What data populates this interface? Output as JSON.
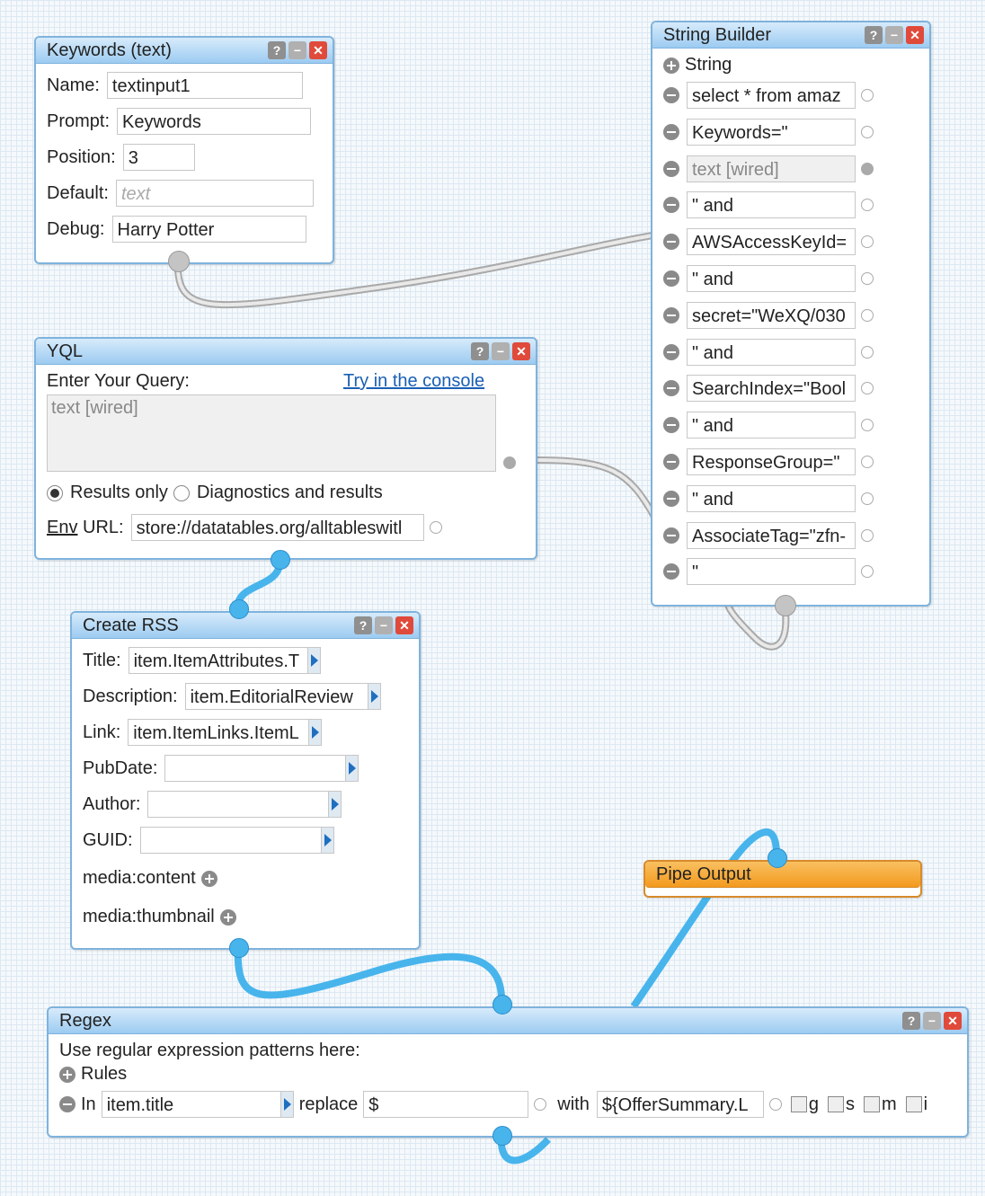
{
  "keywords_module": {
    "title": "Keywords (text)",
    "fields": [
      {
        "label": "Name:",
        "value": "textinput1"
      },
      {
        "label": "Prompt:",
        "value": "Keywords"
      },
      {
        "label": "Position:",
        "value": "3"
      },
      {
        "label": "Default:",
        "value": "text"
      },
      {
        "label": "Debug:",
        "value": "Harry Potter"
      }
    ]
  },
  "string_builder": {
    "title": "String Builder",
    "header_label": "String",
    "items": [
      "select * from amaz",
      "Keywords=\"",
      "text [wired]",
      "\" and",
      "AWSAccessKeyId=",
      "\" and",
      "secret=\"WeXQ/030",
      "\" and",
      "SearchIndex=\"Bool",
      "\" and",
      "ResponseGroup=\"",
      "\" and",
      "AssociateTag=\"zfn-",
      "\""
    ]
  },
  "yql_module": {
    "title": "YQL",
    "query_label": "Enter Your Query:",
    "console_link": "Try in the console",
    "query_value": "text [wired]",
    "radio_results_only": "Results only",
    "radio_diagnostics": "Diagnostics and results",
    "env_label_underlined": "Env",
    "env_label_rest": " URL:",
    "env_value": "store://datatables.org/alltableswitl"
  },
  "create_rss": {
    "title": "Create RSS",
    "fields": [
      {
        "label": "Title:",
        "value": "item.ItemAttributes.T"
      },
      {
        "label": "Description:",
        "value": "item.EditorialReview"
      },
      {
        "label": "Link:",
        "value": "item.ItemLinks.ItemL"
      },
      {
        "label": "PubDate:",
        "value": ""
      },
      {
        "label": "Author:",
        "value": ""
      },
      {
        "label": "GUID:",
        "value": ""
      }
    ],
    "media_content": "media:content",
    "media_thumbnail": "media:thumbnail"
  },
  "pipe_output": {
    "title": "Pipe Output"
  },
  "regex_module": {
    "title": "Regex",
    "description": "Use regular expression patterns here:",
    "rules_label": "Rules",
    "in_label": "In",
    "in_value": "item.title",
    "replace_label": "replace",
    "replace_value": "$",
    "with_label": "with",
    "with_value": "${OfferSummary.L",
    "flags": [
      "g",
      "s",
      "m",
      "i"
    ]
  },
  "window_buttons": {
    "help": "?"
  },
  "colors": {
    "wire_blue": "#48b4ec",
    "wire_grey": "#bdbdbd",
    "header_blue": "#9ccbf1",
    "pipe_output_orange": "#f39a1e"
  }
}
